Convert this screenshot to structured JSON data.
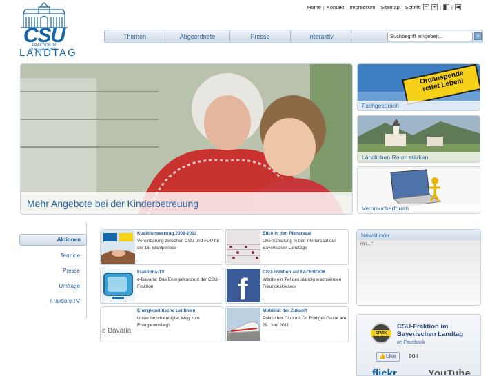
{
  "logo": {
    "csu": "CSU",
    "fraktion": "FRAKTION IM BAYERISCHEN",
    "landtag": "LANDTAG"
  },
  "toplinks": {
    "home": "Home",
    "kontakt": "Kontakt",
    "impressum": "Impressum",
    "sitemap": "Sitemap",
    "schrift": "Schrift:",
    "minus": "−",
    "plus": "+"
  },
  "nav": {
    "tabs": [
      "Themen",
      "Abgeordnete",
      "Presse",
      "Interaktiv"
    ],
    "search_placeholder": "Suchbegriff eingeben...",
    "search_button": "»"
  },
  "hero": {
    "caption": "Mehr Angebote bei der Kinderbetreuung"
  },
  "teasers": [
    {
      "label": "Fachgespräch",
      "sign": "Organspende rettet Leben!"
    },
    {
      "label": "Ländlichen Raum stärken"
    },
    {
      "label": "Verbraucherforum"
    }
  ],
  "aktionen": {
    "header": "Aktionen",
    "items": [
      "Termine",
      "Presse",
      "Umfrage",
      "FraktionsTV"
    ]
  },
  "boxes": [
    {
      "title": "Koalitionsvertrag 2008-2013",
      "desc": "Vereinbarung zwischen CSU und FDP für die 16. Wahlperiode",
      "thumb": "handshake"
    },
    {
      "title": "Blick in den Plenarsaal",
      "desc": "Live-Schaltung in den Plenarsaal des Bayerischen Landtags",
      "thumb": "plenarsaal"
    },
    {
      "title": "Fraktions-TV",
      "desc": "e-Bavaria: Das Energiekonzept der CSU-Fraktion",
      "thumb": "tv"
    },
    {
      "title": "CSU-Fraktion auf FACEBOOK",
      "desc": "Werde ein Teil des ständig wachsenden Freundeskreises",
      "thumb": "facebook"
    },
    {
      "title": "Energiepolitische Leitlinien",
      "desc": "Unser beschleunigter Weg zum Energieumstieg!",
      "thumb": "ebavaria",
      "thumb_text": "e Bavaria"
    },
    {
      "title": "Mobilität der Zukunft",
      "desc": "Politischer Club mit Dr. Rüdiger Grube am 29. Juni 2011",
      "thumb": "train"
    }
  ],
  "news": {
    "header": "Newsticker",
    "text": "im L...\""
  },
  "facebook": {
    "name": "CSU-Fraktion im Bayerischen Landtag",
    "sub": "on Facebook",
    "like": "Like",
    "count": "904",
    "flickr": "flickr",
    "youtube": "YouTube",
    "badge": "STARK"
  },
  "colors": {
    "brand": "#1565a8",
    "link": "#2a63a0"
  }
}
